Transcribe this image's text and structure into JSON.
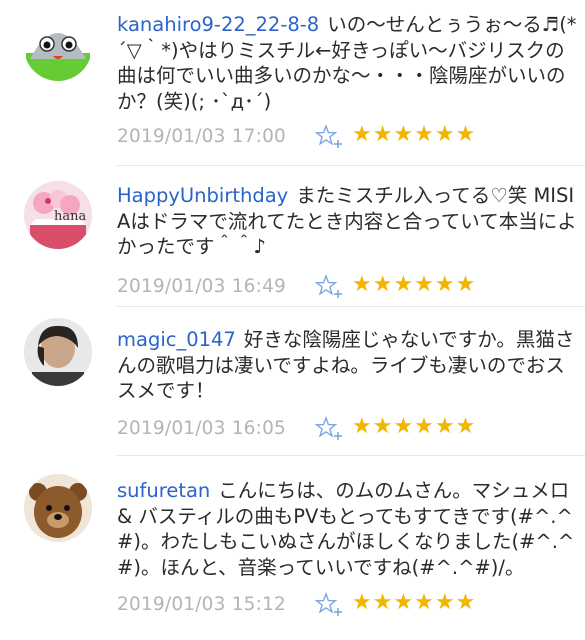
{
  "comments": [
    {
      "user": "kanahiro9-22_22-8-8",
      "text": "いの～せんとぅうぉ～る♬(*´▽｀*)やはりミスチル←好きっぽい～バジリスクの曲は何でいい曲多いのかな～・・・陰陽座がいいのか？(笑)(; ･`д･´)",
      "date": "2019/01/03 17:00",
      "stars": "★★★★★★",
      "avatar_icon": "green-robot-icon"
    },
    {
      "user": "HappyUnbirthday",
      "text": "またミスチル入ってる♡笑 MISIAはドラマで流れてたとき内容と合っていて本当によかったです＾＾♪",
      "date": "2019/01/03 16:49",
      "stars": "★★★★★★",
      "avatar_icon": "cupcake-icon",
      "avatar_text": "hana"
    },
    {
      "user": "magic_0147",
      "text": "好きな陰陽座じゃないですか。黒猫さんの歌唱力は凄いですよね。ライブも凄いのでおススメです！",
      "date": "2019/01/03 16:05",
      "stars": "★★★★★★",
      "avatar_icon": "person-photo-icon"
    },
    {
      "user": "sufuretan",
      "text": "こんにちは、のムのムさん。マシュメロ & バスティルの曲もPVもとってもすてきです(#^.^#)。わたしもこいぬさんがほしくなりました(#^.^#)。ほんと、音楽っていいですね(#^.^#)/。",
      "date": "2019/01/03 15:12",
      "stars": "★★★★★★",
      "avatar_icon": "teddy-bear-icon"
    }
  ],
  "colors": {
    "username": "#2a63c9",
    "star": "#f2b600",
    "add_star": "#7ea6e0",
    "date": "#b4b4b4",
    "text": "#2b2b2b"
  }
}
